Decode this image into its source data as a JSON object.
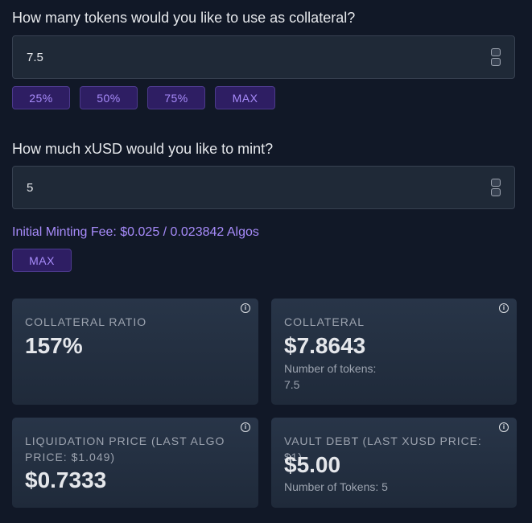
{
  "collateral": {
    "question": "How many tokens would you like to use as collateral?",
    "value": "7.5",
    "buttons": [
      "25%",
      "50%",
      "75%",
      "MAX"
    ]
  },
  "mint": {
    "question": "How much xUSD would you like to mint?",
    "value": "5",
    "fee": "Initial Minting Fee: $0.025 / 0.023842 Algos",
    "max_button": "MAX"
  },
  "cards": {
    "collateral_ratio": {
      "label": "COLLATERAL RATIO",
      "value": "157%"
    },
    "collateral_value": {
      "label": "COLLATERAL",
      "value": "$7.8643",
      "sub_label": "Number of tokens:",
      "sub_value": "7.5"
    },
    "liquidation_price": {
      "label": "LIQUIDATION PRICE (LAST ALGO PRICE: $1.049)",
      "value": "$0.7333"
    },
    "vault_debt": {
      "label": "VAULT DEBT (LAST XUSD PRICE: $1)",
      "value": "$5.00",
      "sub": "Number of Tokens: 5"
    }
  },
  "colors": {
    "background": "#111827",
    "accent": "#a78bfa",
    "button_bg": "#2e1e63",
    "card_bg": "#283548"
  },
  "icons": {
    "info": "info-icon",
    "stepper": "number-stepper-icon"
  }
}
